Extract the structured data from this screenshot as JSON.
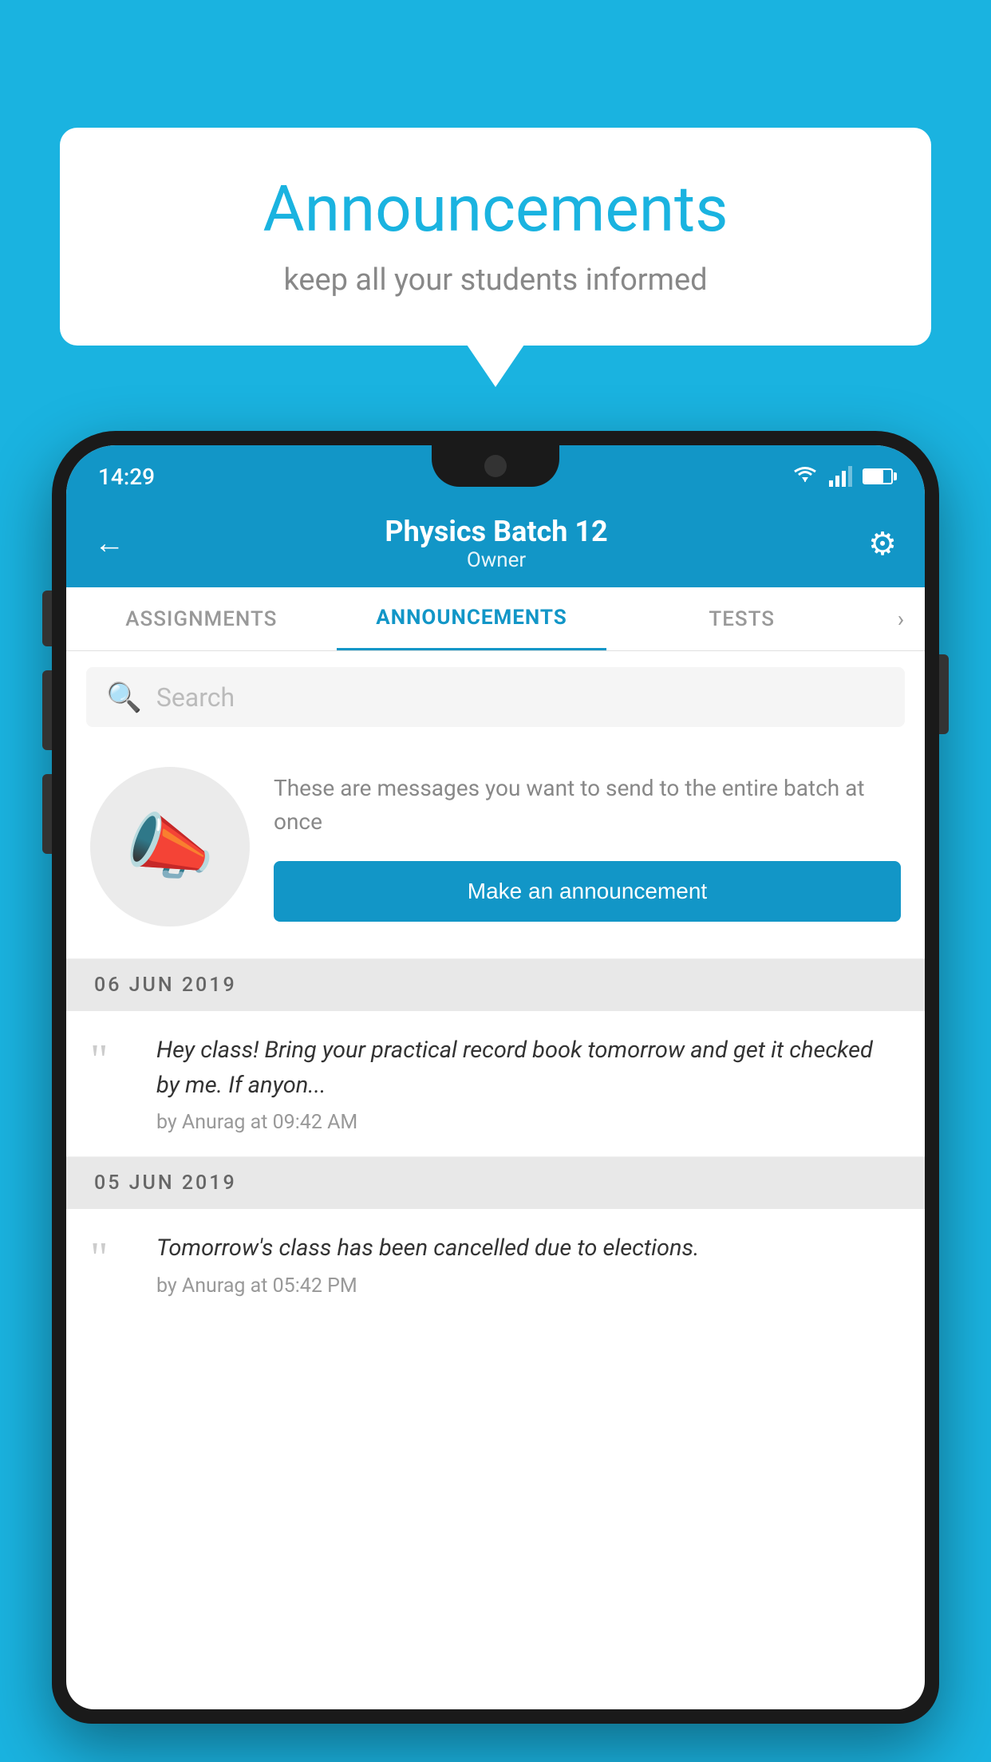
{
  "page": {
    "background_color": "#1ab3e0"
  },
  "speech_bubble": {
    "title": "Announcements",
    "subtitle": "keep all your students informed"
  },
  "status_bar": {
    "time": "14:29"
  },
  "app_header": {
    "title": "Physics Batch 12",
    "subtitle": "Owner",
    "back_label": "←",
    "settings_label": "⚙"
  },
  "tabs": [
    {
      "label": "ASSIGNMENTS",
      "active": false
    },
    {
      "label": "ANNOUNCEMENTS",
      "active": true
    },
    {
      "label": "TESTS",
      "active": false
    },
    {
      "label": "›",
      "active": false,
      "more": true
    }
  ],
  "search": {
    "placeholder": "Search"
  },
  "announcement_prompt": {
    "description": "These are messages you want to send to the entire batch at once",
    "button_label": "Make an announcement"
  },
  "date_groups": [
    {
      "date": "06  JUN  2019",
      "items": [
        {
          "message": "Hey class! Bring your practical record book tomorrow and get it checked by me. If anyon...",
          "meta": "by Anurag at 09:42 AM"
        }
      ]
    },
    {
      "date": "05  JUN  2019",
      "items": [
        {
          "message": "Tomorrow's class has been cancelled due to elections.",
          "meta": "by Anurag at 05:42 PM"
        }
      ]
    }
  ]
}
